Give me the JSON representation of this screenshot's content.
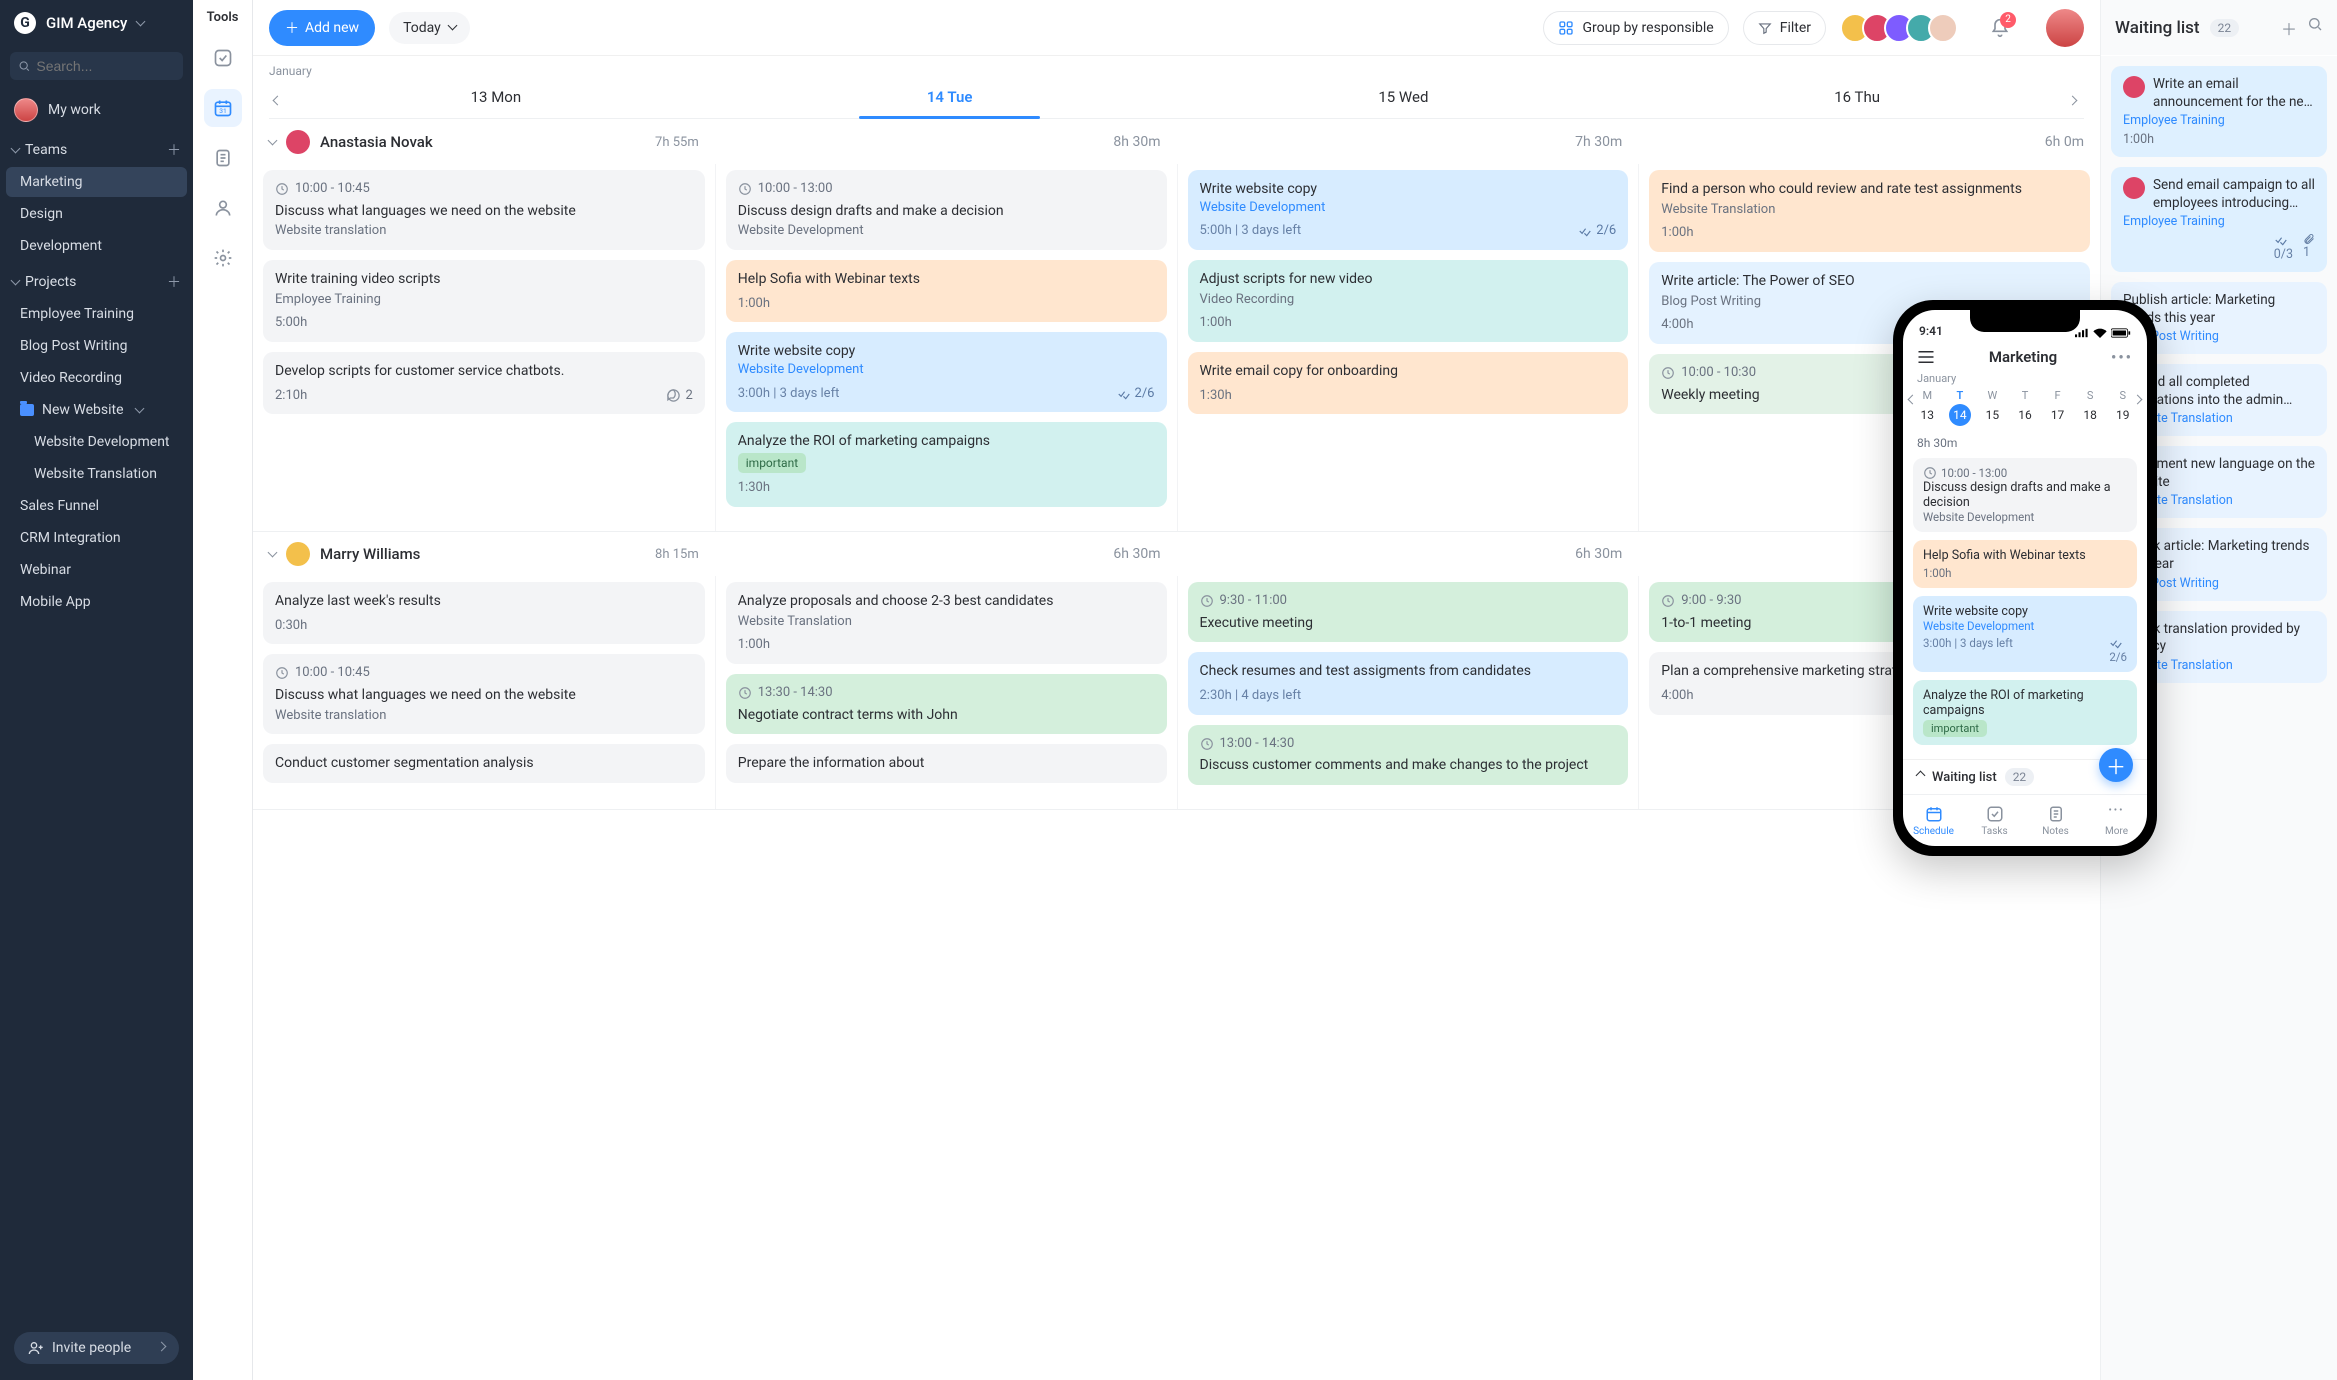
{
  "agency": "GIM Agency",
  "search_placeholder": "Search...",
  "my_work": "My work",
  "sections": {
    "teams": "Teams",
    "projects": "Projects"
  },
  "teams": [
    "Marketing",
    "Design",
    "Development"
  ],
  "projects": {
    "list": [
      "Employee Training",
      "Blog Post Writing",
      "Video Recording"
    ],
    "new_website": "New Website",
    "new_website_subs": [
      "Website Development",
      "Website Translation"
    ],
    "rest": [
      "Sales Funnel",
      "CRM Integration",
      "Webinar",
      "Mobile App"
    ]
  },
  "invite": "Invite people",
  "tools_label": "Tools",
  "topbar": {
    "add": "Add new",
    "today": "Today",
    "group_by": "Group by responsible",
    "filter": "Filter",
    "notif_count": "2"
  },
  "cal": {
    "month": "January",
    "days": [
      "13 Mon",
      "14 Tue",
      "15 Wed",
      "16 Thu"
    ]
  },
  "persons": [
    {
      "name": "Anastasia Novak",
      "avatar_color": "#d46",
      "times": [
        "7h 55m",
        "8h 30m",
        "7h 30m",
        "6h 0m"
      ],
      "cols": [
        [
          {
            "cls": "c-gray",
            "time": "10:00 - 10:45",
            "title": "Discuss what languages we need on the website",
            "sub": "Website translation"
          },
          {
            "cls": "c-gray",
            "title": "Write training video scripts",
            "sub": "Employee Training",
            "duration": "5:00h"
          },
          {
            "cls": "c-gray",
            "title": "Develop scripts for customer service chatbots.",
            "duration": "2:10h",
            "comments": "2"
          }
        ],
        [
          {
            "cls": "c-gray",
            "time": "10:00 - 13:00",
            "title": "Discuss design drafts and make a decision",
            "sub": "Website Development"
          },
          {
            "cls": "c-orange",
            "title": "Help Sofia with Webinar texts",
            "duration": "1:00h"
          },
          {
            "cls": "c-blue",
            "title": "Write website copy",
            "blue_sub": "Website Development",
            "meta_left": "3:00h | 3 days left",
            "meta_right": "2/6"
          },
          {
            "cls": "c-teal",
            "title": "Analyze the ROI of marketing campaigns",
            "tag": "important",
            "duration": "1:30h"
          }
        ],
        [
          {
            "cls": "c-blue",
            "title": "Write website copy",
            "blue_sub": "Website Development",
            "meta_left": "5:00h | 3 days left",
            "meta_right": "2/6"
          },
          {
            "cls": "c-teal",
            "title": "Adjust scripts for new video",
            "sub": "Video Recording",
            "duration": "1:00h"
          },
          {
            "cls": "c-orange",
            "title": "Write email copy for onboarding",
            "duration": "1:30h"
          }
        ],
        [
          {
            "cls": "c-orange",
            "title": "Find a person who could review and rate test assignments",
            "sub": "Website Translation",
            "duration": "1:00h"
          },
          {
            "cls": "c-lightblue",
            "title": "Write article: The Power of SEO",
            "sub": "Blog Post Writing",
            "duration": "4:00h"
          },
          {
            "cls": "c-ltgreen",
            "time": "10:00 - 10:30",
            "title": "Weekly meeting",
            "truncated": true
          }
        ]
      ]
    },
    {
      "name": "Marry Williams",
      "avatar_color": "#f3c04b",
      "times": [
        "8h 15m",
        "6h 30m",
        "6h 30m",
        ""
      ],
      "cols": [
        [
          {
            "cls": "c-gray",
            "title": "Analyze last week's results",
            "duration": "0:30h"
          },
          {
            "cls": "c-gray",
            "time": "10:00 - 10:45",
            "title": "Discuss what languages we need on the website",
            "sub": "Website translation"
          },
          {
            "cls": "c-gray",
            "title": "Conduct customer segmentation analysis"
          }
        ],
        [
          {
            "cls": "c-gray",
            "title": "Analyze proposals and choose 2-3 best candidates",
            "sub": "Website Translation",
            "duration": "1:00h"
          },
          {
            "cls": "c-green",
            "time": "13:30 - 14:30",
            "title": "Negotiate contract terms with John"
          },
          {
            "cls": "c-gray",
            "title": "Prepare the information about"
          }
        ],
        [
          {
            "cls": "c-green",
            "time": "9:30 - 11:00",
            "title": "Executive meeting"
          },
          {
            "cls": "c-blue",
            "title": "Check resumes and test assigments from candidates",
            "meta_left": "2:30h | 4 days left"
          },
          {
            "cls": "c-green",
            "time": "13:00 - 14:30",
            "title": "Discuss customer comments and make changes to the project"
          }
        ],
        [
          {
            "cls": "c-green",
            "time": "9:00 - 9:30",
            "title": "1-to-1 meeting",
            "truncated": true
          },
          {
            "cls": "c-gray",
            "title": "Plan a comprehensive marketing strategy",
            "duration": "4:00h",
            "truncated": true
          }
        ]
      ]
    }
  ],
  "waiting": {
    "title": "Waiting list",
    "count": "22",
    "items": [
      {
        "avatar": "#d46",
        "title": "Write an email announcement for the ne…",
        "sub": "Employee Training",
        "dur": "1:00h"
      },
      {
        "avatar": "#d46",
        "title": "Send email campaign to all employees introducing…",
        "sub": "Employee Training",
        "meta_check": "0/3",
        "meta_attach": "1"
      },
      {
        "title": "Publish article: Marketing trends this year",
        "sub": "Blog Post Writing",
        "cut": true
      },
      {
        "title": "Upload all completed translations into the admin…",
        "sub": "Website Translation",
        "cut": true
      },
      {
        "title": "Implement new language on the website",
        "sub": "Website Translation",
        "cut": true
      },
      {
        "title": "Check article: Marketing trends this year",
        "sub": "Blog Post Writing",
        "cut": true
      },
      {
        "title": "Check translation provided by agency",
        "sub": "Website Translation",
        "cut": true
      }
    ]
  },
  "phone": {
    "clock": "9:41",
    "title": "Marketing",
    "month": "January",
    "days_head": [
      "M",
      "T",
      "W",
      "T",
      "F",
      "S",
      "S"
    ],
    "days_nums": [
      "13",
      "14",
      "15",
      "16",
      "17",
      "18",
      "19"
    ],
    "duration_top": "8h 30m",
    "cards": [
      {
        "cls": "c-gray",
        "time": "10:00 - 13:00",
        "title": "Discuss design drafts and make a decision",
        "sub": "Website Development"
      },
      {
        "cls": "c-orange",
        "title": "Help Sofia with Webinar texts",
        "dur": "1:00h"
      },
      {
        "cls": "c-blue",
        "title": "Write website copy",
        "bsub": "Website Development",
        "meta_left": "3:00h | 3 days left",
        "meta_right": "2/6"
      },
      {
        "cls": "c-teal",
        "title": "Analyze the ROI of marketing campaigns",
        "tag": "important"
      }
    ],
    "waiting_label": "Waiting list",
    "waiting_count": "22",
    "tabs": [
      "Schedule",
      "Tasks",
      "Notes",
      "More"
    ]
  }
}
